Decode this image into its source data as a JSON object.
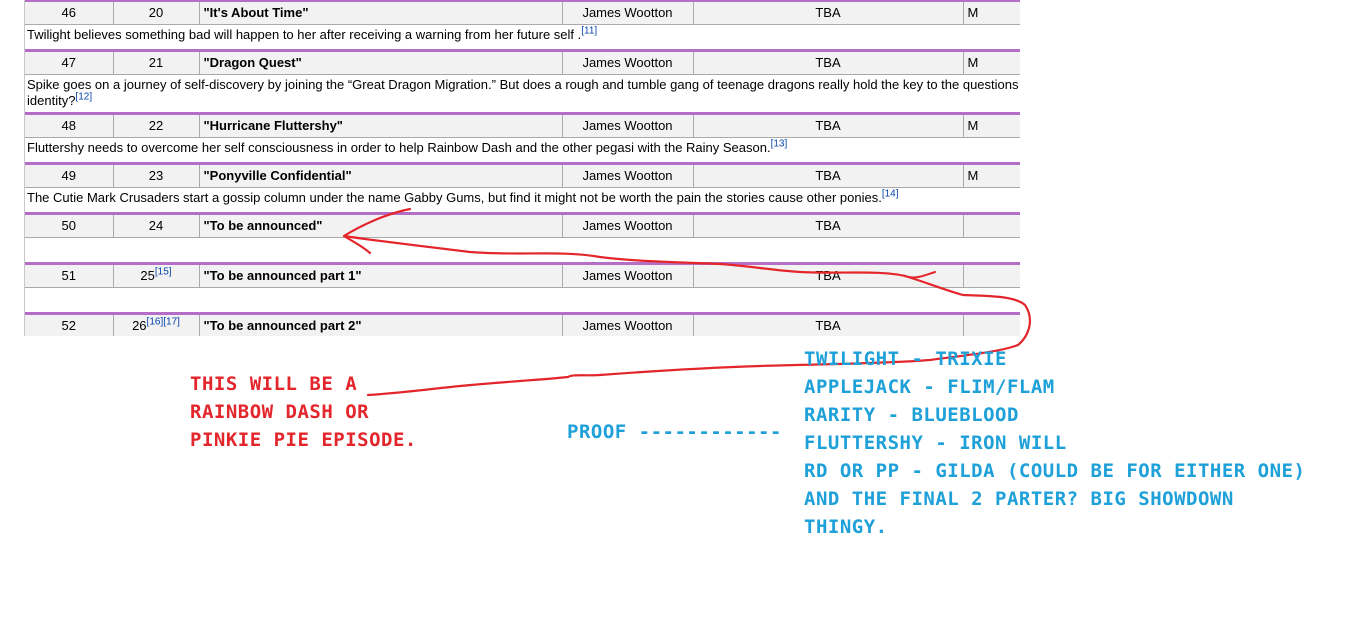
{
  "episodes": [
    {
      "overall": "46",
      "season": "20",
      "season_ref": "",
      "title": "\"It's About Time\"",
      "writer": "James Wootton",
      "date": "TBA",
      "extra": "M",
      "summary": "Twilight believes something bad will happen to her after receiving a warning from her future self .",
      "ref": "[11]"
    },
    {
      "overall": "47",
      "season": "21",
      "season_ref": "",
      "title": "\"Dragon Quest\"",
      "writer": "James Wootton",
      "date": "TBA",
      "extra": "M",
      "summary": "Spike goes on a journey of self-discovery by joining the “Great Dragon Migration.” But does a rough and tumble gang of teenage dragons really hold the key to the questions identity?",
      "ref": "[12]"
    },
    {
      "overall": "48",
      "season": "22",
      "season_ref": "",
      "title": "\"Hurricane Fluttershy\"",
      "writer": "James Wootton",
      "date": "TBA",
      "extra": "M",
      "summary": "Fluttershy needs to overcome her self consciousness in order to help Rainbow Dash and the other pegasi with the Rainy Season.",
      "ref": "[13]"
    },
    {
      "overall": "49",
      "season": "23",
      "season_ref": "",
      "title": "\"Ponyville Confidential\"",
      "writer": "James Wootton",
      "date": "TBA",
      "extra": "M",
      "summary": "The Cutie Mark Crusaders start a gossip column under the name Gabby Gums, but find it might not be worth the pain the stories cause other ponies.",
      "ref": "[14]"
    },
    {
      "overall": "50",
      "season": "24",
      "season_ref": "",
      "title": "\"To be announced\"",
      "writer": "James Wootton",
      "date": "TBA",
      "extra": "",
      "summary": "",
      "ref": ""
    },
    {
      "overall": "51",
      "season": "25",
      "season_ref": "[15]",
      "title": "\"To be announced part 1\"",
      "writer": "James Wootton",
      "date": "TBA",
      "extra": "",
      "summary": "",
      "ref": ""
    },
    {
      "overall": "52",
      "season": "26",
      "season_ref": "[16][17]",
      "title": "\"To be announced part 2\"",
      "writer": "James Wootton",
      "date": "TBA",
      "extra": "",
      "summary": "",
      "ref": ""
    }
  ],
  "annotations": {
    "red_note_lines": [
      "THIS WILL BE A",
      "RAINBOW DASH OR",
      "PINKIE PIE EPISODE."
    ],
    "proof_label": "PROOF ------------",
    "blue_lines": [
      "TWILIGHT - TRIXIE",
      "APPLEJACK - FLIM/FLAM",
      "RARITY - BLUEBLOOD",
      "FLUTTERSHY - IRON WILL",
      "RD OR PP - GILDA (COULD BE FOR EITHER ONE)",
      "AND THE FINAL 2 PARTER? BIG SHOWDOWN",
      "THINGY."
    ],
    "colors": {
      "red": "#e3262b",
      "blue": "#1ea0d8",
      "row_border": "#b46ec8"
    }
  }
}
